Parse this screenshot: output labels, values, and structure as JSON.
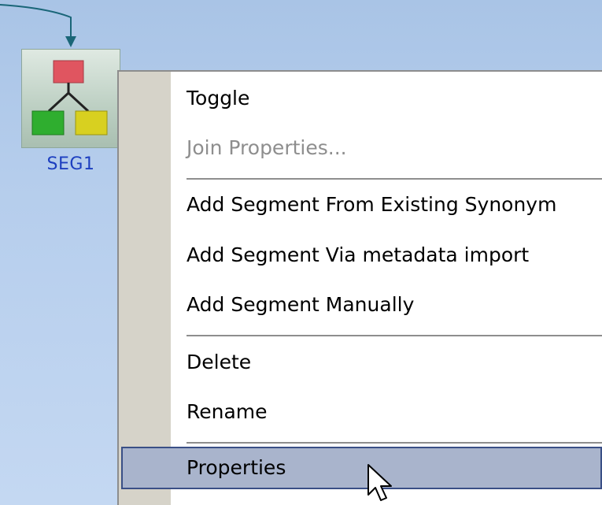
{
  "node": {
    "label": "SEG1",
    "icon": "segment-hierarchy-icon"
  },
  "context_menu": {
    "items": [
      {
        "label": "Toggle",
        "enabled": true
      },
      {
        "label": "Join Properties...",
        "enabled": false
      },
      {
        "label": "Add Segment From Existing Synonym",
        "enabled": true
      },
      {
        "label": "Add Segment Via metadata import",
        "enabled": true
      },
      {
        "label": "Add Segment Manually",
        "enabled": true
      },
      {
        "label": "Delete",
        "enabled": true
      },
      {
        "label": "Rename",
        "enabled": true
      },
      {
        "label": "Properties",
        "enabled": true,
        "selected": true
      }
    ]
  },
  "colors": {
    "background": "#b5cdec",
    "node_label": "#1d3fc0",
    "menu_gutter": "#d6d3c9",
    "selected_fill": "#a9b4cc",
    "selected_border": "#3a4f86",
    "disabled_text": "#8e8e8e",
    "icon_red": "#e05560",
    "icon_green": "#2fae2f",
    "icon_yellow": "#d8d020",
    "connector": "#1a6678"
  },
  "cursor": "arrow-pointer-icon"
}
